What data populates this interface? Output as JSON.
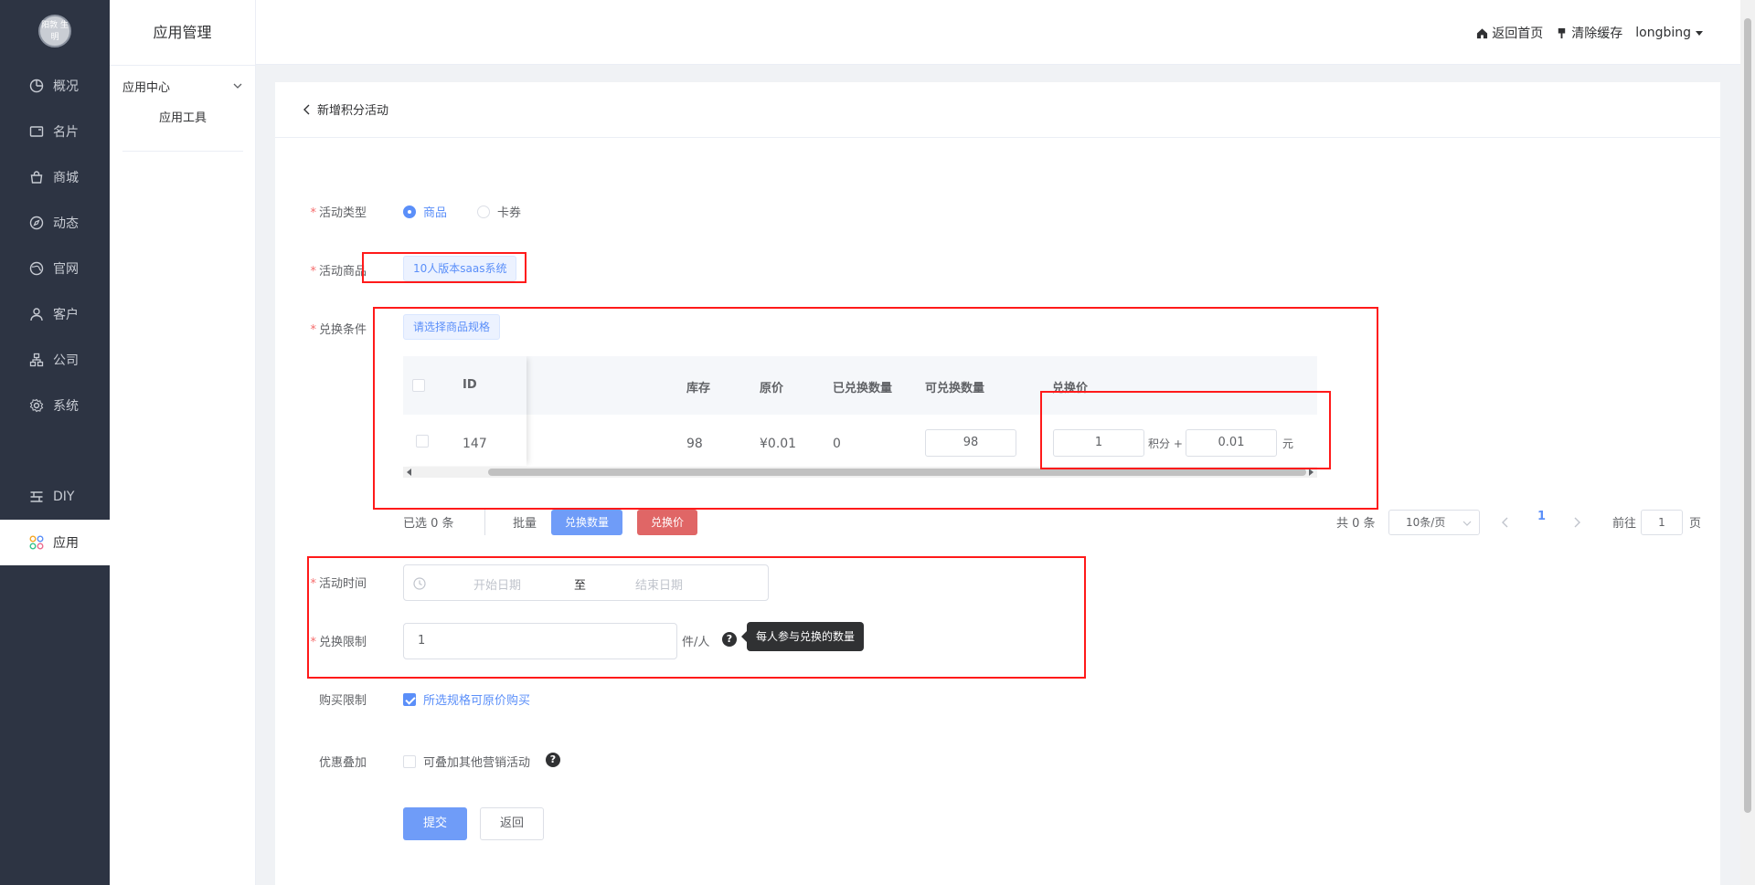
{
  "nav": {
    "logo_text": "阳敦\n生明",
    "items": [
      "概况",
      "名片",
      "商城",
      "动态",
      "官网",
      "客户",
      "公司",
      "系统",
      "DIY",
      "应用"
    ]
  },
  "sub": {
    "title": "应用管理",
    "group": "应用中心",
    "tool": "应用工具"
  },
  "header": {
    "home": "返回首页",
    "clear": "清除缓存",
    "user": "longbing"
  },
  "page": {
    "crumb": "新增积分活动"
  },
  "form": {
    "type_label": "活动类型",
    "type_options": [
      "商品",
      "卡券"
    ],
    "goods_label": "活动商品",
    "goods_tag": "10人版本saas系统",
    "cond_label": "兑换条件",
    "cond_button": "请选择商品规格",
    "table": {
      "headers": [
        "ID",
        "库存",
        "原价",
        "已兑换数量",
        "可兑换数量",
        "兑换价"
      ],
      "row": {
        "id": "147",
        "stock": "98",
        "price": "¥0.01",
        "exchanged": "0",
        "available": "98",
        "points": "1",
        "points_unit": "积分 +",
        "cash": "0.01",
        "cash_unit": "元"
      }
    },
    "selected": "已选 0 条",
    "batch": "批量",
    "batch_qty": "兑换数量",
    "batch_price": "兑换价",
    "pager": {
      "total": "共 0 条",
      "size": "10条/页",
      "current": "1",
      "goto": "前往",
      "goto_value": "1",
      "page_unit": "页"
    },
    "time_label": "活动时间",
    "start_placeholder": "开始日期",
    "range_sep": "至",
    "end_placeholder": "结束日期",
    "limit_label": "兑换限制",
    "limit_value": "1",
    "limit_unit": "件/人",
    "limit_tip": "每人参与兑换的数量",
    "buy_label": "购买限制",
    "buy_option": "所选规格可原价购买",
    "stack_label": "优惠叠加",
    "stack_option": "可叠加其他营销活动",
    "submit": "提交",
    "back": "返回"
  }
}
